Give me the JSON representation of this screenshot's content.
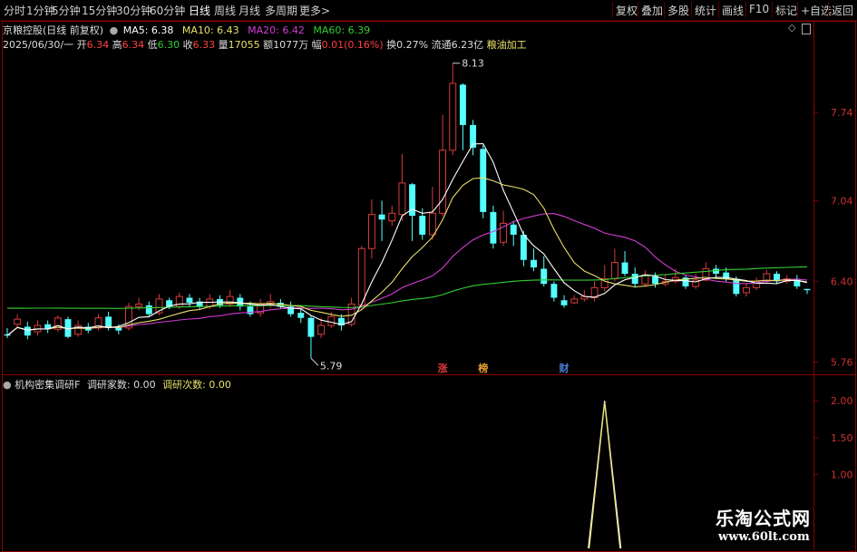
{
  "toolbar": {
    "left": [
      "分时",
      "1分钟",
      "5分钟",
      "15分钟",
      "30分钟",
      "60分钟",
      "日线",
      "周线",
      "月线",
      "多周期",
      "更多>"
    ],
    "right": [
      "复权",
      "叠加",
      "多股",
      "统计",
      "画线",
      "F10",
      "标记",
      "+自选",
      "返回"
    ]
  },
  "header": {
    "stock_title": "京粮控股(日线 前复权)",
    "ma5": "MA5: 6.38",
    "ma10": "MA10: 6.43",
    "ma20": "MA20: 6.42",
    "ma60": "MA60: 6.39",
    "date": "2025/06/30/一",
    "open_lbl": "开",
    "open_val": "6.34",
    "high_lbl": "高",
    "high_val": "6.34",
    "low_lbl": "低",
    "low_val": "6.30",
    "close_lbl": "收",
    "close_val": "6.33",
    "vol_lbl": "量",
    "vol_val": "17055",
    "amt_lbl": "额",
    "amt_val": "1077万",
    "chg_lbl": "幅",
    "chg_val": "0.01",
    "chg_pct": "(0.16%)",
    "turn_lbl": "换",
    "turn_val": "0.27%",
    "float_lbl": "流通",
    "float_val": "6.23亿",
    "industry": "粮油加工"
  },
  "colors": {
    "up": "#d83a3a",
    "down": "#54ffff",
    "ma5": "#ffffff",
    "ma10": "#e8e06a",
    "ma20": "#d43cd4",
    "ma60": "#33cc33",
    "grid": "#8b0000"
  },
  "chart_data": [
    {
      "type": "candlestick",
      "y_ticks": [
        "7.74",
        "7.04",
        "6.40",
        "5.76"
      ],
      "ylim": [
        5.72,
        8.2
      ],
      "max_label": "8.13",
      "min_label": "5.79",
      "markers": [
        "涨",
        "榜",
        "财"
      ],
      "candles": [
        [
          5.98,
          5.97,
          6.03,
          5.95
        ],
        [
          6.06,
          6.1,
          6.14,
          6.03
        ],
        [
          6.04,
          5.97,
          6.08,
          5.94
        ],
        [
          6.0,
          6.05,
          6.09,
          5.97
        ],
        [
          6.06,
          6.02,
          6.09,
          5.99
        ],
        [
          6.02,
          6.11,
          6.13,
          6.0
        ],
        [
          6.1,
          5.96,
          6.12,
          5.95
        ],
        [
          5.98,
          6.05,
          6.09,
          5.96
        ],
        [
          6.04,
          6.01,
          6.07,
          5.99
        ],
        [
          6.03,
          6.11,
          6.14,
          6.01
        ],
        [
          6.12,
          6.03,
          6.16,
          6.01
        ],
        [
          6.04,
          6.01,
          6.06,
          5.98
        ],
        [
          6.03,
          6.2,
          6.23,
          6.01
        ],
        [
          6.2,
          6.22,
          6.27,
          6.17
        ],
        [
          6.21,
          6.14,
          6.24,
          6.12
        ],
        [
          6.15,
          6.26,
          6.3,
          6.13
        ],
        [
          6.25,
          6.2,
          6.27,
          6.18
        ],
        [
          6.2,
          6.28,
          6.31,
          6.18
        ],
        [
          6.27,
          6.23,
          6.3,
          6.2
        ],
        [
          6.24,
          6.2,
          6.27,
          6.18
        ],
        [
          6.2,
          6.26,
          6.3,
          6.18
        ],
        [
          6.26,
          6.21,
          6.29,
          6.19
        ],
        [
          6.22,
          6.28,
          6.33,
          6.2
        ],
        [
          6.27,
          6.2,
          6.3,
          6.17
        ],
        [
          6.2,
          6.14,
          6.24,
          6.12
        ],
        [
          6.15,
          6.22,
          6.26,
          6.12
        ],
        [
          6.22,
          6.24,
          6.3,
          6.19
        ],
        [
          6.23,
          6.2,
          6.26,
          6.18
        ],
        [
          6.2,
          6.14,
          6.24,
          6.12
        ],
        [
          6.15,
          6.11,
          6.18,
          6.07
        ],
        [
          6.11,
          5.96,
          6.13,
          5.79
        ],
        [
          5.98,
          6.05,
          6.11,
          5.95
        ],
        [
          6.05,
          6.12,
          6.16,
          6.03
        ],
        [
          6.11,
          6.05,
          6.14,
          6.01
        ],
        [
          6.06,
          6.22,
          6.27,
          6.04
        ],
        [
          6.21,
          6.66,
          6.68,
          6.18
        ],
        [
          6.66,
          6.93,
          7.05,
          6.58
        ],
        [
          6.93,
          6.89,
          7.04,
          6.72
        ],
        [
          6.88,
          6.94,
          7.0,
          6.84
        ],
        [
          6.93,
          7.18,
          7.41,
          6.88
        ],
        [
          7.17,
          6.92,
          7.18,
          6.72
        ],
        [
          6.92,
          6.77,
          6.98,
          6.73
        ],
        [
          6.77,
          6.94,
          7.15,
          6.73
        ],
        [
          6.94,
          7.44,
          7.72,
          6.92
        ],
        [
          7.44,
          7.97,
          8.13,
          7.4
        ],
        [
          7.96,
          7.64,
          7.97,
          7.44
        ],
        [
          7.64,
          7.46,
          7.68,
          7.4
        ],
        [
          7.45,
          6.95,
          7.48,
          6.9
        ],
        [
          6.95,
          6.7,
          7.0,
          6.66
        ],
        [
          6.71,
          6.86,
          6.96,
          6.68
        ],
        [
          6.85,
          6.77,
          6.88,
          6.68
        ],
        [
          6.77,
          6.57,
          6.8,
          6.52
        ],
        [
          6.57,
          6.51,
          6.66,
          6.48
        ],
        [
          6.5,
          6.38,
          6.6,
          6.36
        ],
        [
          6.38,
          6.27,
          6.4,
          6.24
        ],
        [
          6.25,
          6.21,
          6.29,
          6.19
        ],
        [
          6.23,
          6.26,
          6.29,
          6.22
        ],
        [
          6.26,
          6.28,
          6.33,
          6.24
        ],
        [
          6.27,
          6.35,
          6.4,
          6.24
        ],
        [
          6.35,
          6.42,
          6.53,
          6.32
        ],
        [
          6.42,
          6.55,
          6.66,
          6.4
        ],
        [
          6.55,
          6.46,
          6.64,
          6.44
        ],
        [
          6.46,
          6.38,
          6.51,
          6.35
        ],
        [
          6.38,
          6.45,
          6.49,
          6.36
        ],
        [
          6.44,
          6.38,
          6.47,
          6.35
        ],
        [
          6.38,
          6.4,
          6.46,
          6.36
        ],
        [
          6.4,
          6.43,
          6.5,
          6.38
        ],
        [
          6.43,
          6.36,
          6.45,
          6.34
        ],
        [
          6.36,
          6.41,
          6.46,
          6.34
        ],
        [
          6.41,
          6.5,
          6.55,
          6.4
        ],
        [
          6.5,
          6.46,
          6.53,
          6.42
        ],
        [
          6.47,
          6.42,
          6.51,
          6.4
        ],
        [
          6.42,
          6.3,
          6.44,
          6.28
        ],
        [
          6.31,
          6.35,
          6.38,
          6.28
        ],
        [
          6.35,
          6.4,
          6.43,
          6.33
        ],
        [
          6.4,
          6.46,
          6.49,
          6.38
        ],
        [
          6.46,
          6.4,
          6.48,
          6.38
        ],
        [
          6.4,
          6.42,
          6.45,
          6.38
        ],
        [
          6.42,
          6.36,
          6.45,
          6.34
        ],
        [
          6.34,
          6.33,
          6.34,
          6.3
        ]
      ]
    },
    {
      "type": "line",
      "title": "机构密集调研F",
      "series": [
        {
          "name": "调研家数",
          "last": "0.00"
        },
        {
          "name": "调研次数",
          "last": "0.00"
        }
      ],
      "y_ticks": [
        "2.00",
        "1.50",
        "1.00"
      ],
      "ylim": [
        0,
        2.15
      ],
      "spike_x_index": 59,
      "spike_value": 2.0
    }
  ],
  "indicator_header": {
    "name": "机构密集调研F",
    "s1": "调研家数: 0.00",
    "s2": "调研次数: 0.00"
  },
  "watermark": {
    "title": "乐淘公式网",
    "url": "www.60lt.com"
  }
}
